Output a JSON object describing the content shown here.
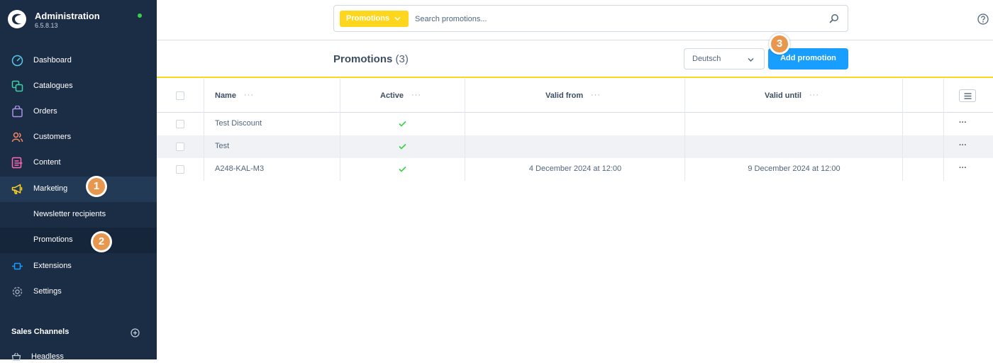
{
  "app": {
    "title": "Administration",
    "version": "6.5.8.13"
  },
  "sidebar": {
    "items": [
      {
        "label": "Dashboard",
        "icon": "dashboard-icon"
      },
      {
        "label": "Catalogues",
        "icon": "catalogues-icon"
      },
      {
        "label": "Orders",
        "icon": "orders-icon"
      },
      {
        "label": "Customers",
        "icon": "customers-icon"
      },
      {
        "label": "Content",
        "icon": "content-icon"
      },
      {
        "label": "Marketing",
        "icon": "megaphone-icon",
        "active": true
      },
      {
        "label": "Extensions",
        "icon": "extensions-icon"
      },
      {
        "label": "Settings",
        "icon": "gear-icon"
      }
    ],
    "marketing_children": [
      {
        "label": "Newsletter recipients"
      },
      {
        "label": "Promotions",
        "selected": true
      }
    ],
    "sales_channels": {
      "title": "Sales Channels",
      "items": [
        {
          "label": "Headless"
        }
      ]
    }
  },
  "badges": [
    "1",
    "2",
    "3"
  ],
  "search": {
    "type_label": "Promotions",
    "placeholder": "Search promotions..."
  },
  "header": {
    "title": "Promotions",
    "count": "(3)",
    "language": "Deutsch",
    "add_button": "Add promotion"
  },
  "table": {
    "columns": [
      "Name",
      "Active",
      "Valid from",
      "Valid until"
    ],
    "column_menu": "···",
    "rows": [
      {
        "name": "Test Discount",
        "active": true,
        "valid_from": "",
        "valid_until": ""
      },
      {
        "name": "Test",
        "active": true,
        "valid_from": "",
        "valid_until": ""
      },
      {
        "name": "A248-KAL-M3",
        "active": true,
        "valid_from": "4 December 2024 at 12:00",
        "valid_until": "9 December 2024 at 12:00"
      }
    ],
    "row_menu": "···"
  },
  "colors": {
    "sidebar_bg": "#1b2d45",
    "accent_yellow": "#ffd61e",
    "primary_blue": "#189eff",
    "badge_orange": "#e7974e",
    "success_green": "#37d046"
  }
}
